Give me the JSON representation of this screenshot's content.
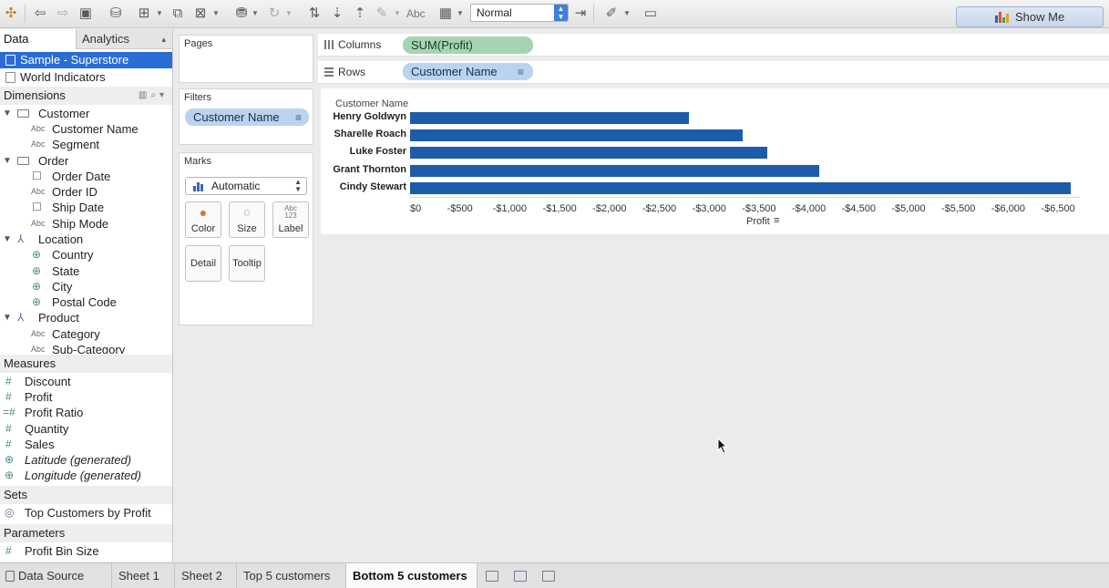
{
  "toolbar": {
    "fit_value": "Normal",
    "abc_label": "Abc",
    "show_me_label": "Show Me",
    "show_me_colors": [
      "#2e63b4",
      "#d9542a",
      "#5b9a3a",
      "#e0a030"
    ]
  },
  "data_pane": {
    "tabs": {
      "data": "Data",
      "analytics": "Analytics"
    },
    "data_sources": [
      {
        "label": "Sample - Superstore",
        "active": true
      },
      {
        "label": "World Indicators",
        "active": false
      }
    ],
    "dimensions_header": "Dimensions",
    "dimension_folders": [
      {
        "folder": "Customer",
        "fields": [
          "Customer Name",
          "Segment"
        ]
      },
      {
        "folder": "Order",
        "fields": [
          "Order Date",
          "Order ID",
          "Ship Date",
          "Ship Mode"
        ]
      },
      {
        "folder": "Location",
        "fields": [
          "Country",
          "State",
          "City",
          "Postal Code"
        ]
      },
      {
        "folder": "Product",
        "fields": [
          "Category",
          "Sub-Category"
        ]
      }
    ],
    "type_glyphs": {
      "string": "Abc",
      "date": "☐",
      "geo": "⊕",
      "number": "#"
    },
    "measures_header": "Measures",
    "measures": [
      "Discount",
      "Profit",
      "Profit Ratio",
      "Quantity",
      "Sales",
      "Latitude (generated)",
      "Longitude (generated)"
    ],
    "sets_header": "Sets",
    "sets": [
      "Top Customers by Profit"
    ],
    "parameters_header": "Parameters",
    "parameters": [
      "Profit Bin Size"
    ]
  },
  "cards": {
    "pages_title": "Pages",
    "filters_title": "Filters",
    "filter_pill": "Customer Name",
    "marks_title": "Marks",
    "mark_type": "Automatic",
    "mark_buttons": {
      "color": "Color",
      "size": "Size",
      "label": "Label",
      "label_abc": "Abc",
      "label_123": "123",
      "detail": "Detail",
      "tooltip": "Tooltip"
    }
  },
  "shelves": {
    "columns_label": "Columns",
    "columns_pill": "SUM(Profit)",
    "rows_label": "Rows",
    "rows_pill": "Customer Name"
  },
  "chart_data": {
    "type": "bar",
    "orientation": "horizontal",
    "row_header": "Customer Name",
    "categories": [
      "Henry Goldwyn",
      "Sharelle Roach",
      "Luke Foster",
      "Grant Thornton",
      "Cindy Stewart"
    ],
    "values": [
      -2797,
      -3334,
      -3583,
      -4108,
      -6627
    ],
    "xlabel": "Profit",
    "xlim": [
      0,
      -6700
    ],
    "xticks": [
      0,
      -500,
      -1000,
      -1500,
      -2000,
      -2500,
      -3000,
      -3500,
      -4000,
      -4500,
      -5000,
      -5500,
      -6000,
      -6500
    ],
    "xtick_labels": [
      "$0",
      "-$500",
      "-$1,000",
      "-$1,500",
      "-$2,000",
      "-$2,500",
      "-$3,000",
      "-$3,500",
      "-$4,000",
      "-$4,500",
      "-$5,000",
      "-$5,500",
      "-$6,000",
      "-$6,500"
    ],
    "bar_color": "#1c5cab"
  },
  "bottom_tabs": {
    "data_source": "Data Source",
    "sheets": [
      "Sheet 1",
      "Sheet 2",
      "Top 5 customers",
      "Bottom 5 customers"
    ],
    "active_index": 3
  }
}
